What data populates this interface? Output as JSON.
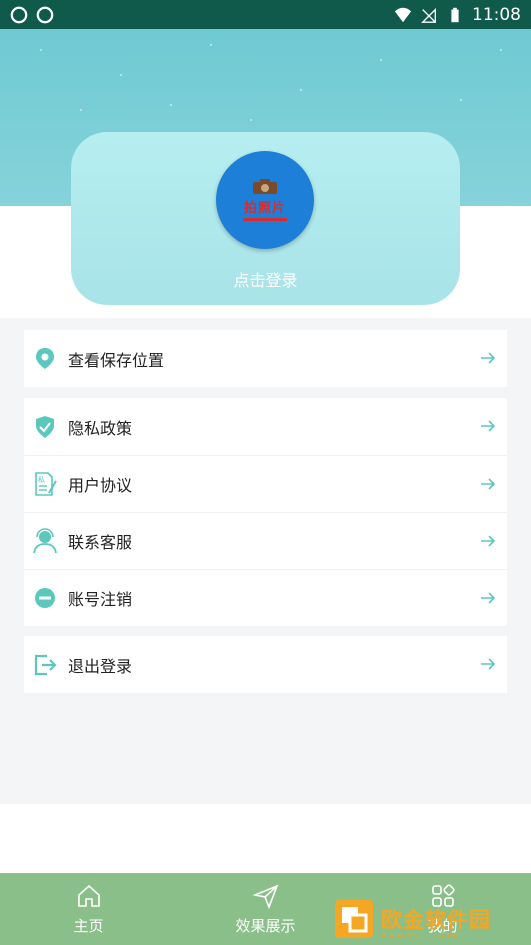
{
  "status_bar": {
    "time": "11:08"
  },
  "profile": {
    "login_text": "点击登录",
    "logo_text": "拍照片"
  },
  "menu": {
    "group1": [
      {
        "label": "查看保存位置",
        "icon": "location-pin-icon"
      }
    ],
    "group2": [
      {
        "label": "隐私政策",
        "icon": "shield-check-icon"
      },
      {
        "label": "用户协议",
        "icon": "document-icon"
      },
      {
        "label": "联系客服",
        "icon": "customer-service-icon"
      },
      {
        "label": "账号注销",
        "icon": "minus-circle-icon"
      }
    ],
    "group3": [
      {
        "label": "退出登录",
        "icon": "logout-icon"
      }
    ]
  },
  "bottom_nav": [
    {
      "label": "主页",
      "icon": "home-icon"
    },
    {
      "label": "效果展示",
      "icon": "send-icon"
    },
    {
      "label": "我的",
      "icon": "grid-icon"
    }
  ],
  "watermark": {
    "text": "欧金软件园",
    "url": "www.ouj....com"
  },
  "colors": {
    "accent": "#5cc8bd",
    "status_bar": "#0f5a4a",
    "nav_bg": "#8abf8a",
    "avatar_bg": "#1e7fd8"
  }
}
